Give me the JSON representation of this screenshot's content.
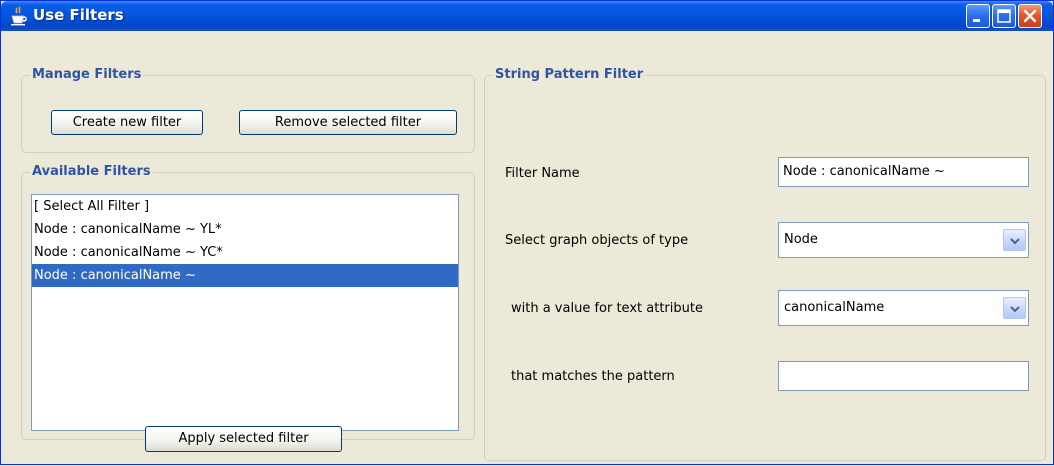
{
  "window": {
    "title": "Use Filters",
    "controls": {
      "minimize": "minimize-icon",
      "maximize": "maximize-icon",
      "close": "close-icon"
    }
  },
  "manage_filters": {
    "label": "Manage Filters",
    "create_button": "Create new filter",
    "remove_button": "Remove selected filter"
  },
  "available_filters": {
    "label": "Available Filters",
    "items": [
      {
        "text": "[ Select All Filter ]",
        "selected": false
      },
      {
        "text": "Node : canonicalName ~ YL*",
        "selected": false
      },
      {
        "text": "Node : canonicalName ~ YC*",
        "selected": false
      },
      {
        "text": "Node : canonicalName ~",
        "selected": true
      }
    ],
    "apply_button": "Apply selected filter"
  },
  "string_pattern_filter": {
    "label": "String Pattern Filter",
    "filter_name_label": "Filter Name",
    "filter_name_value": "Node : canonicalName ~",
    "object_type_label": "Select graph objects of type",
    "object_type_value": "Node",
    "attribute_label": "with a value for text attribute",
    "attribute_value": "canonicalName",
    "pattern_label": "that matches the pattern",
    "pattern_value": ""
  },
  "colors": {
    "title_bar": "#0454dc",
    "group_label": "#2e54a3",
    "selection": "#316ac5",
    "window_bg": "#ece9d8"
  }
}
